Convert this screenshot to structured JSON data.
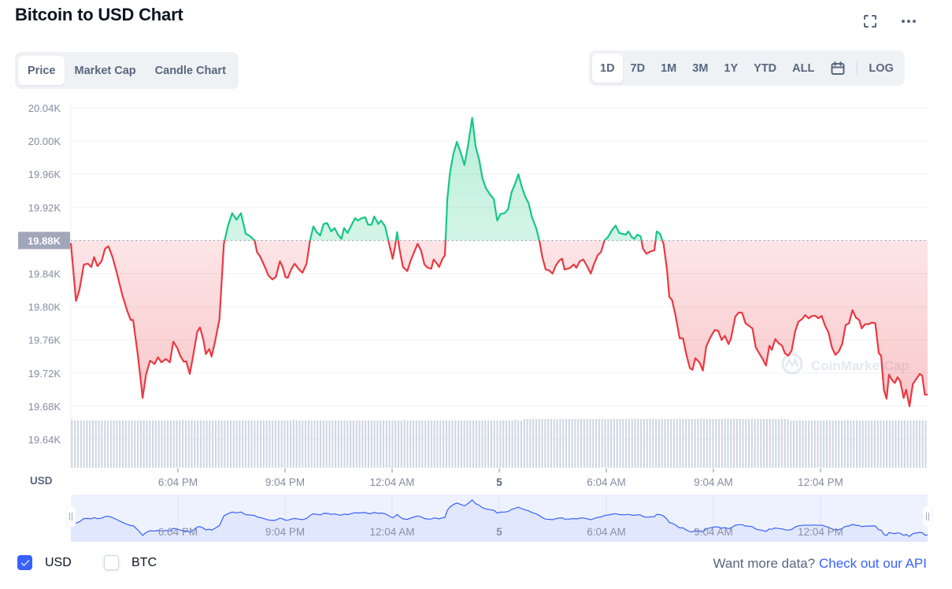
{
  "header": {
    "title": "Bitcoin to USD Chart",
    "fullscreen_icon": "fullscreen-icon",
    "more_icon": "more-horizontal-icon"
  },
  "chart_type_tabs": [
    {
      "label": "Price",
      "active": true
    },
    {
      "label": "Market Cap",
      "active": false
    },
    {
      "label": "Candle Chart",
      "active": false
    }
  ],
  "range_tabs": [
    {
      "label": "1D",
      "active": true
    },
    {
      "label": "7D",
      "active": false
    },
    {
      "label": "1M",
      "active": false
    },
    {
      "label": "3M",
      "active": false
    },
    {
      "label": "1Y",
      "active": false
    },
    {
      "label": "YTD",
      "active": false
    },
    {
      "label": "ALL",
      "active": false
    }
  ],
  "calendar_icon": "calendar-icon",
  "log_label": "LOG",
  "colors": {
    "up": "#16c784",
    "down": "#ea3943",
    "accent": "#3861fb",
    "volume": "#cfd6e4",
    "navigator_line": "#3861fb",
    "navigator_fill": "#dfe6fd"
  },
  "chart_data": {
    "type": "line",
    "title": "Bitcoin to USD Chart",
    "xlabel": "",
    "ylabel": "USD",
    "y_unit_label": "USD",
    "ylim": [
      19.61,
      20.05
    ],
    "y_ticks": [
      20.04,
      20.0,
      19.96,
      19.92,
      19.88,
      19.84,
      19.8,
      19.76,
      19.72,
      19.68,
      19.64
    ],
    "y_tick_labels": [
      "20.04K",
      "20.00K",
      "19.96K",
      "19.92K",
      "19.88K",
      "19.84K",
      "19.80K",
      "19.76K",
      "19.72K",
      "19.68K",
      "19.64K"
    ],
    "baseline": 19.88,
    "baseline_label": "19.88K",
    "x_range_hours": [
      0,
      24
    ],
    "x_ticks": [
      {
        "hour": 1,
        "label": "6:04 PM",
        "bold": false
      },
      {
        "hour": 4,
        "label": "9:04 PM",
        "bold": false
      },
      {
        "hour": 7,
        "label": "12:04 AM",
        "bold": false
      },
      {
        "hour": 10,
        "label": "5",
        "bold": true
      },
      {
        "hour": 13,
        "label": "6:04 AM",
        "bold": false
      },
      {
        "hour": 16,
        "label": "9:04 AM",
        "bold": false
      },
      {
        "hour": 19,
        "label": "12:04 PM",
        "bold": false
      }
    ],
    "grid": true,
    "watermark": "CoinMarketCap",
    "series": [
      {
        "name": "Price (USD, thousands)",
        "points": [
          [
            0.0,
            19.877
          ],
          [
            0.15,
            19.807
          ],
          [
            0.25,
            19.82
          ],
          [
            0.38,
            19.851
          ],
          [
            0.5,
            19.852
          ],
          [
            0.6,
            19.848
          ],
          [
            0.68,
            19.86
          ],
          [
            0.78,
            19.849
          ],
          [
            0.9,
            19.855
          ],
          [
            1.0,
            19.87
          ],
          [
            1.1,
            19.873
          ],
          [
            1.22,
            19.86
          ],
          [
            1.35,
            19.84
          ],
          [
            1.5,
            19.815
          ],
          [
            1.65,
            19.795
          ],
          [
            1.75,
            19.784
          ],
          [
            1.82,
            19.784
          ],
          [
            1.95,
            19.745
          ],
          [
            2.05,
            19.71
          ],
          [
            2.1,
            19.69
          ],
          [
            2.2,
            19.718
          ],
          [
            2.32,
            19.735
          ],
          [
            2.45,
            19.731
          ],
          [
            2.55,
            19.739
          ],
          [
            2.65,
            19.733
          ],
          [
            2.78,
            19.737
          ],
          [
            2.9,
            19.733
          ],
          [
            3.0,
            19.758
          ],
          [
            3.12,
            19.75
          ],
          [
            3.2,
            19.741
          ],
          [
            3.3,
            19.734
          ],
          [
            3.38,
            19.734
          ],
          [
            3.48,
            19.719
          ],
          [
            3.58,
            19.741
          ],
          [
            3.7,
            19.77
          ],
          [
            3.78,
            19.775
          ],
          [
            3.88,
            19.76
          ],
          [
            3.95,
            19.743
          ],
          [
            4.05,
            19.749
          ],
          [
            4.12,
            19.74
          ],
          [
            4.22,
            19.758
          ],
          [
            4.35,
            19.785
          ],
          [
            4.48,
            19.876
          ],
          [
            4.6,
            19.898
          ],
          [
            4.72,
            19.913
          ],
          [
            4.85,
            19.905
          ],
          [
            4.98,
            19.913
          ],
          [
            5.12,
            19.888
          ],
          [
            5.22,
            19.886
          ],
          [
            5.38,
            19.88
          ],
          [
            5.45,
            19.866
          ],
          [
            5.55,
            19.86
          ],
          [
            5.7,
            19.846
          ],
          [
            5.78,
            19.838
          ],
          [
            5.9,
            19.833
          ],
          [
            6.0,
            19.836
          ],
          [
            6.12,
            19.855
          ],
          [
            6.2,
            19.848
          ],
          [
            6.28,
            19.836
          ],
          [
            6.35,
            19.835
          ],
          [
            6.45,
            19.845
          ],
          [
            6.55,
            19.852
          ],
          [
            6.68,
            19.845
          ],
          [
            6.78,
            19.841
          ],
          [
            6.9,
            19.852
          ],
          [
            7.0,
            19.88
          ],
          [
            7.1,
            19.897
          ],
          [
            7.2,
            19.89
          ],
          [
            7.3,
            19.886
          ],
          [
            7.4,
            19.9
          ],
          [
            7.5,
            19.901
          ],
          [
            7.62,
            19.891
          ],
          [
            7.72,
            19.895
          ],
          [
            7.82,
            19.887
          ],
          [
            7.92,
            19.882
          ],
          [
            8.0,
            19.895
          ],
          [
            8.1,
            19.889
          ],
          [
            8.22,
            19.899
          ],
          [
            8.32,
            19.907
          ],
          [
            8.4,
            19.904
          ],
          [
            8.52,
            19.907
          ],
          [
            8.62,
            19.908
          ],
          [
            8.7,
            19.899
          ],
          [
            8.8,
            19.899
          ],
          [
            8.88,
            19.909
          ],
          [
            9.0,
            19.9
          ],
          [
            9.08,
            19.904
          ],
          [
            9.2,
            19.897
          ],
          [
            9.35,
            19.87
          ],
          [
            9.42,
            19.858
          ],
          [
            9.5,
            19.875
          ],
          [
            9.55,
            19.89
          ],
          [
            9.62,
            19.87
          ],
          [
            9.72,
            19.848
          ],
          [
            9.85,
            19.843
          ],
          [
            9.95,
            19.856
          ],
          [
            10.05,
            19.866
          ],
          [
            10.15,
            19.876
          ],
          [
            10.25,
            19.868
          ],
          [
            10.35,
            19.851
          ],
          [
            10.45,
            19.847
          ],
          [
            10.55,
            19.846
          ],
          [
            10.62,
            19.857
          ],
          [
            10.72,
            19.852
          ],
          [
            10.78,
            19.848
          ],
          [
            10.88,
            19.858
          ],
          [
            10.95,
            19.862
          ],
          [
            11.02,
            19.93
          ],
          [
            11.1,
            19.962
          ],
          [
            11.2,
            19.985
          ],
          [
            11.3,
            19.999
          ],
          [
            11.42,
            19.985
          ],
          [
            11.52,
            19.971
          ],
          [
            11.62,
            19.993
          ],
          [
            11.75,
            20.028
          ],
          [
            11.85,
            19.993
          ],
          [
            11.95,
            19.978
          ],
          [
            12.05,
            19.955
          ],
          [
            12.15,
            19.943
          ],
          [
            12.28,
            19.935
          ],
          [
            12.38,
            19.93
          ],
          [
            12.48,
            19.904
          ],
          [
            12.58,
            19.912
          ],
          [
            12.7,
            19.913
          ],
          [
            12.8,
            19.918
          ],
          [
            12.9,
            19.938
          ],
          [
            13.02,
            19.95
          ],
          [
            13.1,
            19.96
          ],
          [
            13.2,
            19.945
          ],
          [
            13.3,
            19.933
          ],
          [
            13.4,
            19.925
          ],
          [
            13.5,
            19.908
          ],
          [
            13.62,
            19.895
          ],
          [
            13.72,
            19.879
          ],
          [
            13.8,
            19.86
          ],
          [
            13.9,
            19.845
          ],
          [
            14.0,
            19.844
          ],
          [
            14.1,
            19.84
          ],
          [
            14.2,
            19.85
          ],
          [
            14.3,
            19.856
          ],
          [
            14.38,
            19.858
          ],
          [
            14.45,
            19.845
          ],
          [
            14.55,
            19.846
          ],
          [
            14.62,
            19.847
          ],
          [
            14.72,
            19.851
          ],
          [
            14.8,
            19.847
          ],
          [
            14.9,
            19.855
          ],
          [
            15.0,
            19.857
          ],
          [
            15.1,
            19.85
          ],
          [
            15.22,
            19.84
          ],
          [
            15.3,
            19.85
          ],
          [
            15.42,
            19.862
          ],
          [
            15.52,
            19.866
          ],
          [
            15.62,
            19.88
          ],
          [
            15.72,
            19.884
          ],
          [
            15.85,
            19.893
          ],
          [
            15.95,
            19.898
          ],
          [
            16.05,
            19.889
          ],
          [
            16.15,
            19.888
          ],
          [
            16.25,
            19.887
          ],
          [
            16.32,
            19.891
          ],
          [
            16.42,
            19.884
          ],
          [
            16.5,
            19.882
          ],
          [
            16.58,
            19.887
          ],
          [
            16.68,
            19.885
          ],
          [
            16.75,
            19.87
          ],
          [
            16.85,
            19.864
          ],
          [
            16.98,
            19.867
          ],
          [
            17.08,
            19.868
          ],
          [
            17.15,
            19.891
          ],
          [
            17.25,
            19.888
          ],
          [
            17.35,
            19.876
          ],
          [
            17.45,
            19.845
          ],
          [
            17.52,
            19.812
          ],
          [
            17.6,
            19.808
          ],
          [
            17.7,
            19.79
          ],
          [
            17.82,
            19.762
          ],
          [
            17.92,
            19.762
          ],
          [
            18.02,
            19.742
          ],
          [
            18.12,
            19.726
          ],
          [
            18.2,
            19.724
          ],
          [
            18.28,
            19.738
          ],
          [
            18.4,
            19.733
          ],
          [
            18.5,
            19.723
          ],
          [
            18.6,
            19.752
          ],
          [
            18.72,
            19.763
          ],
          [
            18.85,
            19.772
          ],
          [
            18.95,
            19.771
          ],
          [
            19.05,
            19.76
          ],
          [
            19.15,
            19.765
          ],
          [
            19.25,
            19.755
          ],
          [
            19.32,
            19.761
          ],
          [
            19.45,
            19.788
          ],
          [
            19.55,
            19.793
          ],
          [
            19.65,
            19.793
          ],
          [
            19.75,
            19.78
          ],
          [
            19.85,
            19.777
          ],
          [
            19.95,
            19.774
          ],
          [
            20.05,
            19.751
          ],
          [
            20.15,
            19.744
          ],
          [
            20.25,
            19.737
          ],
          [
            20.35,
            19.729
          ],
          [
            20.45,
            19.753
          ],
          [
            20.52,
            19.748
          ],
          [
            20.62,
            19.761
          ],
          [
            20.72,
            19.756
          ],
          [
            20.82,
            19.753
          ],
          [
            20.9,
            19.744
          ],
          [
            21.0,
            19.741
          ],
          [
            21.1,
            19.747
          ],
          [
            21.2,
            19.77
          ],
          [
            21.3,
            19.782
          ],
          [
            21.4,
            19.785
          ],
          [
            21.5,
            19.79
          ],
          [
            21.6,
            19.786
          ],
          [
            21.7,
            19.789
          ],
          [
            21.8,
            19.789
          ],
          [
            21.88,
            19.786
          ],
          [
            21.98,
            19.789
          ],
          [
            22.08,
            19.777
          ],
          [
            22.18,
            19.769
          ],
          [
            22.28,
            19.751
          ],
          [
            22.38,
            19.742
          ],
          [
            22.48,
            19.746
          ],
          [
            22.58,
            19.755
          ],
          [
            22.68,
            19.778
          ],
          [
            22.78,
            19.78
          ],
          [
            22.88,
            19.796
          ],
          [
            22.98,
            19.787
          ],
          [
            23.08,
            19.784
          ],
          [
            23.15,
            19.774
          ],
          [
            23.25,
            19.779
          ],
          [
            23.35,
            19.779
          ],
          [
            23.45,
            19.781
          ],
          [
            23.55,
            19.78
          ],
          [
            23.65,
            19.744
          ],
          [
            23.72,
            19.741
          ],
          [
            23.8,
            19.7
          ],
          [
            23.88,
            19.689
          ],
          [
            23.95,
            19.718
          ],
          [
            24.05,
            19.711
          ],
          [
            24.12,
            19.708
          ],
          [
            24.2,
            19.715
          ],
          [
            24.28,
            19.71
          ],
          [
            24.38,
            19.69
          ],
          [
            24.45,
            19.7
          ],
          [
            24.55,
            19.68
          ],
          [
            24.65,
            19.707
          ],
          [
            24.75,
            19.713
          ],
          [
            24.85,
            19.719
          ],
          [
            24.92,
            19.717
          ],
          [
            25.0,
            19.694
          ],
          [
            25.08,
            19.694
          ]
        ]
      }
    ],
    "volume": {
      "name": "Volume",
      "bar_count": 286,
      "relative_level": 0.78
    },
    "navigator": {
      "tick_labels": [
        "6:04 PM",
        "9:04 PM",
        "12:04 AM",
        "5",
        "6:04 AM",
        "9:04 AM",
        "12:04 PM"
      ],
      "selection": [
        0,
        1
      ]
    }
  },
  "legend": {
    "usd": {
      "label": "USD",
      "checked": true
    },
    "btc": {
      "label": "BTC",
      "checked": false
    }
  },
  "footer": {
    "prompt": "Want more data?",
    "link": "Check out our API"
  }
}
